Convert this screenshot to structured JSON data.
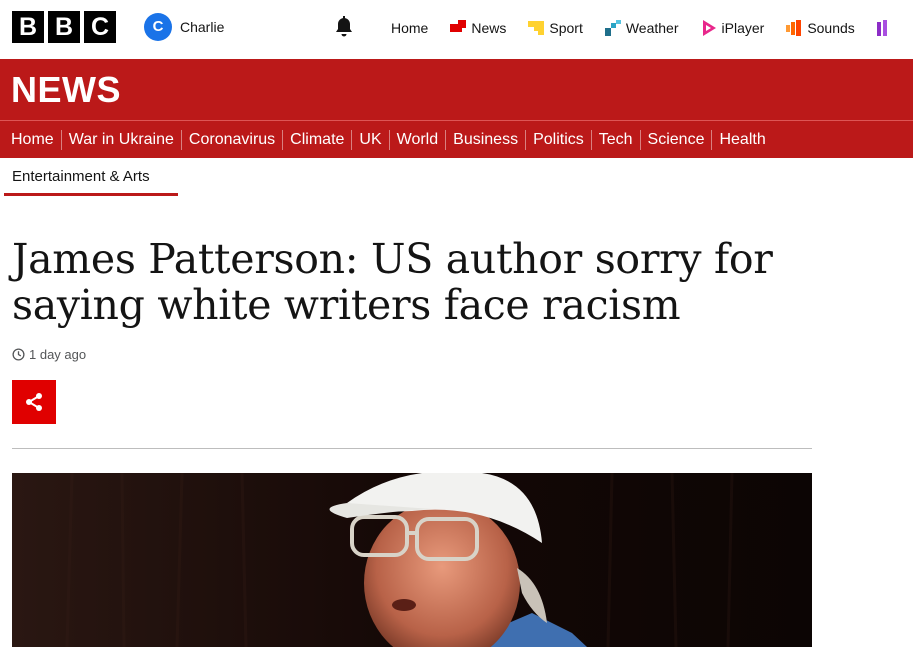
{
  "header": {
    "logo_letters": [
      "B",
      "B",
      "C"
    ],
    "account": {
      "initial": "C",
      "name": "Charlie",
      "avatar_color": "#1a73e8"
    },
    "nav": [
      {
        "label": "Home",
        "icon": ""
      },
      {
        "label": "News",
        "icon": "news-icon",
        "color": "#e00000"
      },
      {
        "label": "Sport",
        "icon": "sport-icon",
        "color": "#ffd230"
      },
      {
        "label": "Weather",
        "icon": "weather-icon",
        "color": "#1f6f8b"
      },
      {
        "label": "iPlayer",
        "icon": "iplayer-icon",
        "color": "#e8278b"
      },
      {
        "label": "Sounds",
        "icon": "sounds-icon",
        "color": "#ff6600"
      }
    ]
  },
  "newsbar": {
    "title": "NEWS",
    "brand_color": "#bb1919",
    "sections": [
      "Home",
      "War in Ukraine",
      "Coronavirus",
      "Climate",
      "UK",
      "World",
      "Business",
      "Politics",
      "Tech",
      "Science",
      "Health"
    ]
  },
  "subnav": {
    "active": "Entertainment & Arts"
  },
  "article": {
    "headline": "James Patterson: US author sorry for saying white writers face racism",
    "timestamp": "1 day ago",
    "share_color": "#e00000"
  }
}
